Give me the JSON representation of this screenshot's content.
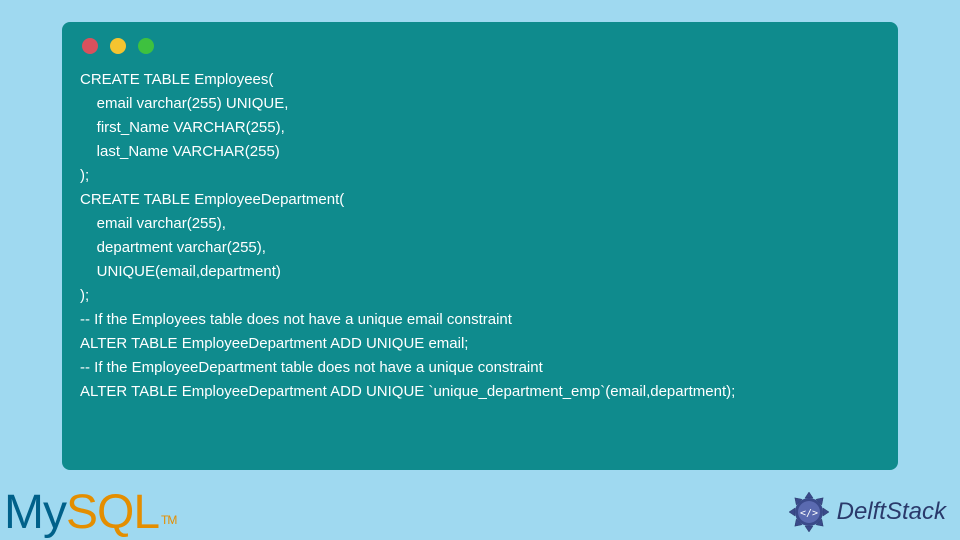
{
  "code": {
    "lines": [
      "CREATE TABLE Employees(",
      "    email varchar(255) UNIQUE,",
      "    first_Name VARCHAR(255),",
      "    last_Name VARCHAR(255)",
      ");",
      "CREATE TABLE EmployeeDepartment(",
      "    email varchar(255),",
      "    department varchar(255),",
      "    UNIQUE(email,department)",
      ");",
      "-- If the Employees table does not have a unique email constraint",
      "ALTER TABLE EmployeeDepartment ADD UNIQUE email;",
      "-- If the EmployeeDepartment table does not have a unique constraint",
      "ALTER TABLE EmployeeDepartment ADD UNIQUE `unique_department_emp`(email,department);"
    ]
  },
  "logos": {
    "mysql_my": "My",
    "mysql_sql": "SQL",
    "mysql_tm": "TM",
    "delftstack": "DelftStack"
  }
}
